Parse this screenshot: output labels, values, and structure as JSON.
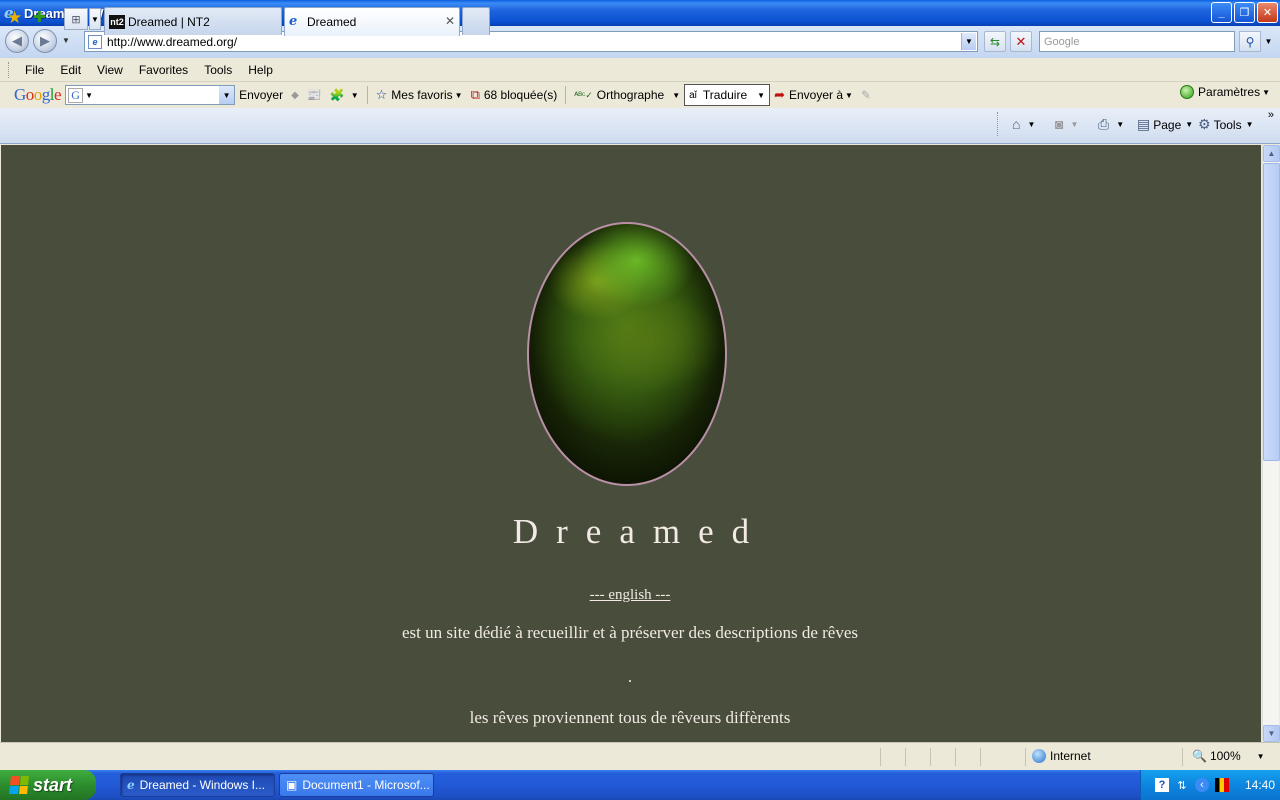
{
  "window": {
    "title": "Dreamed - Windows Internet Explorer",
    "minimize_icon": "minimize-icon",
    "maximize_icon": "restore-icon",
    "close_icon": "close-icon"
  },
  "addressbar": {
    "url": "http://www.dreamed.org/",
    "search_placeholder": "Google"
  },
  "menubar": {
    "items": [
      "File",
      "Edit",
      "View",
      "Favorites",
      "Tools",
      "Help"
    ]
  },
  "google_toolbar": {
    "logo": "Google",
    "envoyer": "Envoyer",
    "mes_favoris": "Mes favoris",
    "blocked": "68 bloquée(s)",
    "orthographe": "Orthographe",
    "traduire": "Traduire",
    "envoyer_a": "Envoyer à",
    "parametres": "Paramètres"
  },
  "tabs": [
    {
      "label": "Dreamed | NT2",
      "active": false
    },
    {
      "label": "Dreamed",
      "active": true
    }
  ],
  "commandbar": {
    "page": "Page",
    "tools": "Tools"
  },
  "content": {
    "site_title": "Dreamed",
    "english_link": "--- english ---",
    "description": "est un site dédié à recueillir et à préserver des descriptions de rêves",
    "separator": ".",
    "description2": "les rêves proviennent tous de rêveurs diffèrents",
    "background_color": "#484d3c",
    "text_color": "#f2eae4"
  },
  "statusbar": {
    "zone": "Internet",
    "zoom": "100%"
  },
  "taskbar": {
    "start": "start",
    "tasks": [
      "Dreamed - Windows I...",
      "Document1 - Microsof..."
    ],
    "clock": "14:40"
  }
}
